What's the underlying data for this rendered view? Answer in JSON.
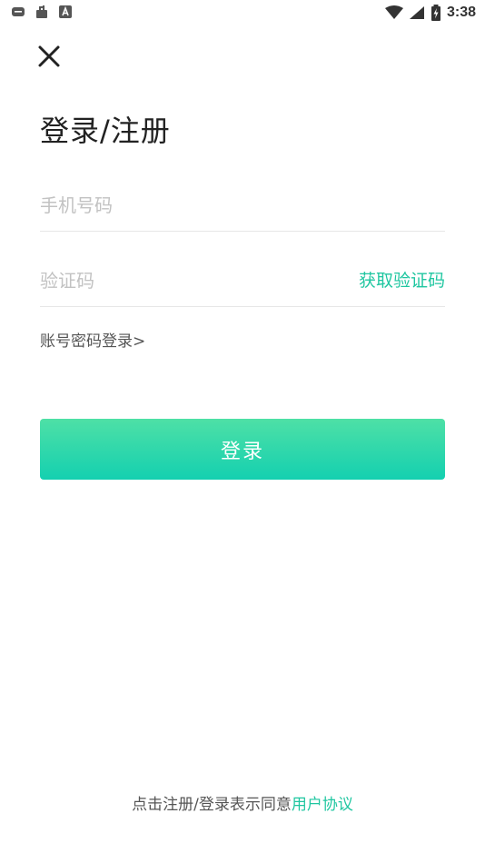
{
  "status_bar": {
    "time": "3:38",
    "left_icons": [
      "message-icon",
      "bag-icon",
      "a-icon"
    ],
    "right_icons": [
      "wifi-icon",
      "signal-icon",
      "battery-icon"
    ]
  },
  "header": {
    "close_icon": "close-icon"
  },
  "title": "登录/注册",
  "form": {
    "phone_placeholder": "手机号码",
    "code_placeholder": "验证码",
    "get_code_label": "获取验证码",
    "password_login_link": "账号密码登录>",
    "login_button_label": "登录"
  },
  "footer": {
    "agreement_text": "点击注册/登录表示同意",
    "agreement_link": "用户协议"
  },
  "colors": {
    "accent": "#1fc6a0",
    "button_gradient_top": "#4ee0a6",
    "button_gradient_bottom": "#14d0b0",
    "placeholder": "#c2c2c2",
    "divider": "#e6e6e6"
  }
}
